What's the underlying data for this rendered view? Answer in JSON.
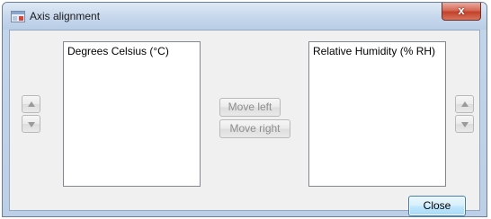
{
  "window": {
    "title": "Axis alignment",
    "close_glyph": "x"
  },
  "left_list": {
    "items": [
      "Degrees Celsius (°C)"
    ]
  },
  "right_list": {
    "items": [
      "Relative Humidity (% RH)"
    ]
  },
  "buttons": {
    "move_left": "Move left",
    "move_right": "Move right",
    "close": "Close"
  },
  "icons": {
    "app": "app-window-icon",
    "up": "triangle-up-icon",
    "down": "triangle-down-icon"
  },
  "colors": {
    "disabled_text": "#8d8d8d",
    "close_button_bg": "#c2412b",
    "default_button_border": "#3c7fb1"
  }
}
